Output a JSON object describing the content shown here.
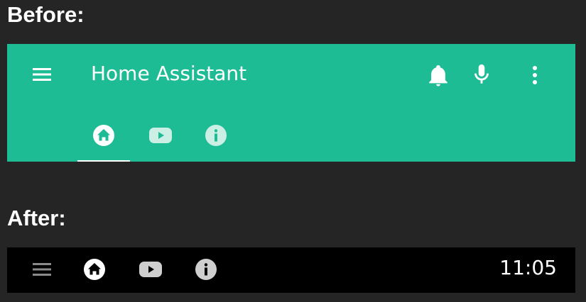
{
  "headings": {
    "before": "Before:",
    "after": "After:"
  },
  "before_toolbar": {
    "title": "Home Assistant",
    "background_color": "#1ebc94",
    "icons": [
      "menu-icon",
      "bell-icon",
      "microphone-icon",
      "more-vert-icon"
    ],
    "tabs": [
      {
        "icon": "home-icon",
        "selected": true
      },
      {
        "icon": "youtube-icon",
        "selected": false
      },
      {
        "icon": "info-icon",
        "selected": false
      }
    ]
  },
  "after_toolbar": {
    "background_color": "#000000",
    "clock": "11:05",
    "icons": [
      "menu-icon",
      "home-icon",
      "youtube-icon",
      "info-icon"
    ]
  }
}
